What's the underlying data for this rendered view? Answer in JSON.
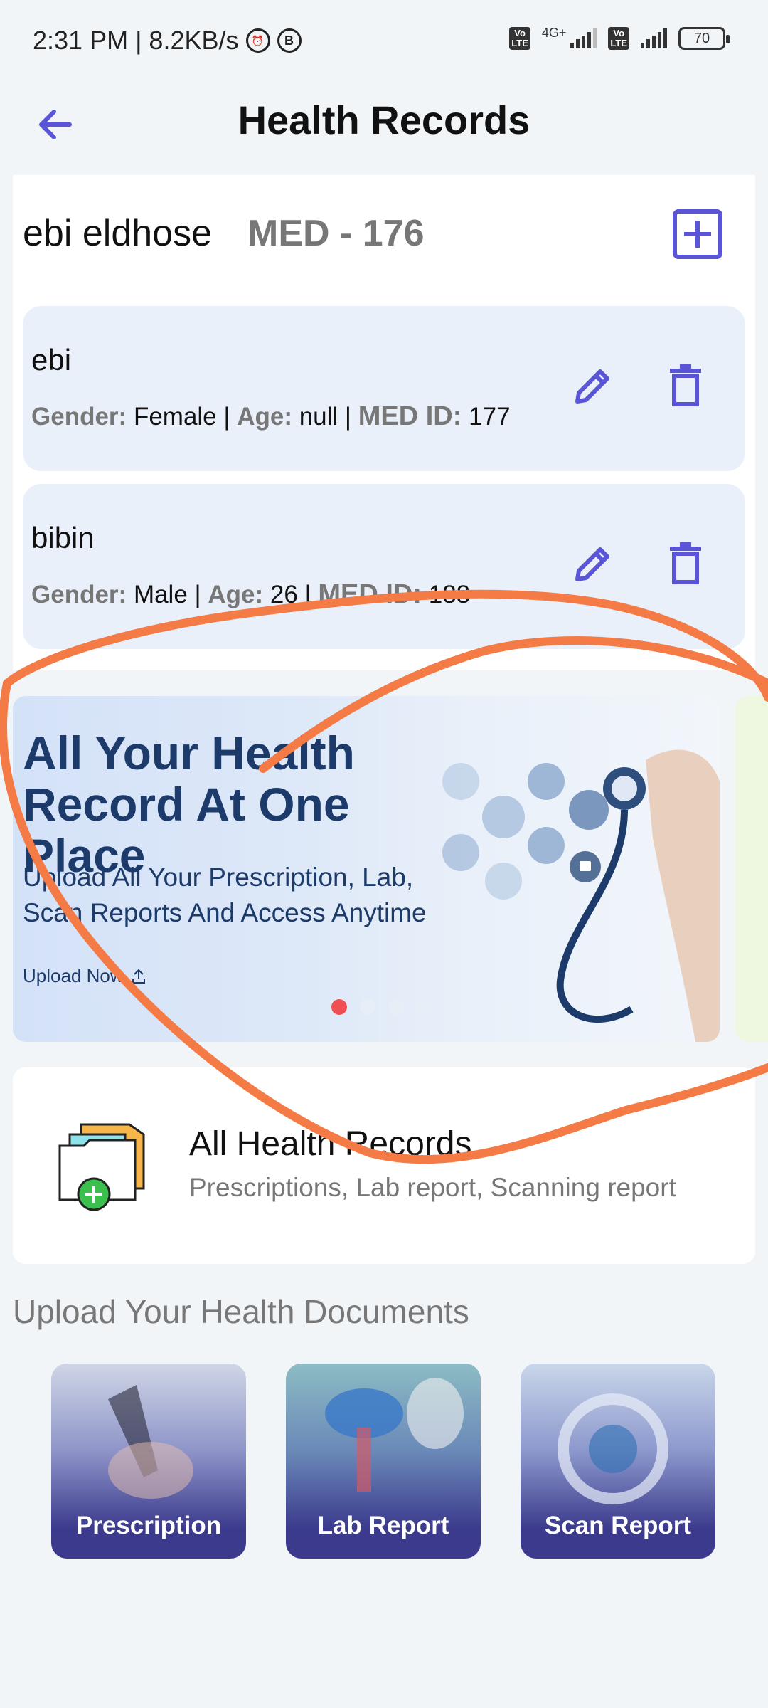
{
  "status_bar": {
    "time": "2:31 PM | 8.2KB/s",
    "network_1": "4G+",
    "battery": "70"
  },
  "header": {
    "title": "Health Records"
  },
  "profile": {
    "name": "ebi eldhose",
    "med_id": "MED - 176"
  },
  "members": [
    {
      "name": "ebi",
      "gender_label": "Gender:",
      "gender": "Female",
      "age_label": "Age:",
      "age": "null",
      "med_id_label": "MED ID:",
      "med_id": "177"
    },
    {
      "name": "bibin",
      "gender_label": "Gender:",
      "gender": "Male",
      "age_label": "Age:",
      "age": "26",
      "med_id_label": "MED ID:",
      "med_id": "188"
    }
  ],
  "banner": {
    "title": "All Your Health Record At One Place",
    "subtitle": "Upload All Your Prescription, Lab, Scan Reports And Access Anytime",
    "cta": "Upload Now",
    "slide_count": 4,
    "active_slide": 0
  },
  "all_records": {
    "title": "All Health Records",
    "subtitle": "Prescriptions, Lab report, Scanning report"
  },
  "upload": {
    "title": "Upload Your Health Documents",
    "tiles": [
      {
        "label": "Prescription"
      },
      {
        "label": "Lab Report"
      },
      {
        "label": "Scan Report"
      }
    ]
  },
  "colors": {
    "accent": "#5a55d6",
    "banner_text": "#1d3b6a",
    "tile_overlay": "#3b3a8c",
    "annotation": "#f47b45",
    "dot_active": "#ef4f53"
  }
}
